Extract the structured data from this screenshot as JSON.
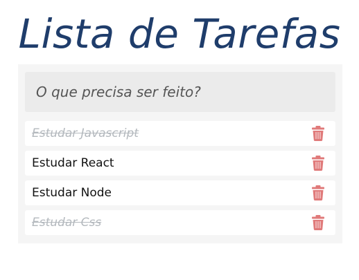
{
  "header": {
    "title": "Lista de Tarefas"
  },
  "new_todo": {
    "placeholder": "O que precisa ser feito?",
    "value": ""
  },
  "todos": [
    {
      "label": "Estudar Javascript",
      "done": true
    },
    {
      "label": "Estudar React",
      "done": false
    },
    {
      "label": "Estudar Node",
      "done": false
    },
    {
      "label": "Estudar Css",
      "done": true
    }
  ],
  "icons": {
    "delete": "trash-icon"
  },
  "colors": {
    "title": "#1f3d6b",
    "delete_icon": "#e07a7a",
    "done_text": "#b3b8bd",
    "panel_bg": "#f5f5f5",
    "input_bg": "#ebebeb"
  }
}
